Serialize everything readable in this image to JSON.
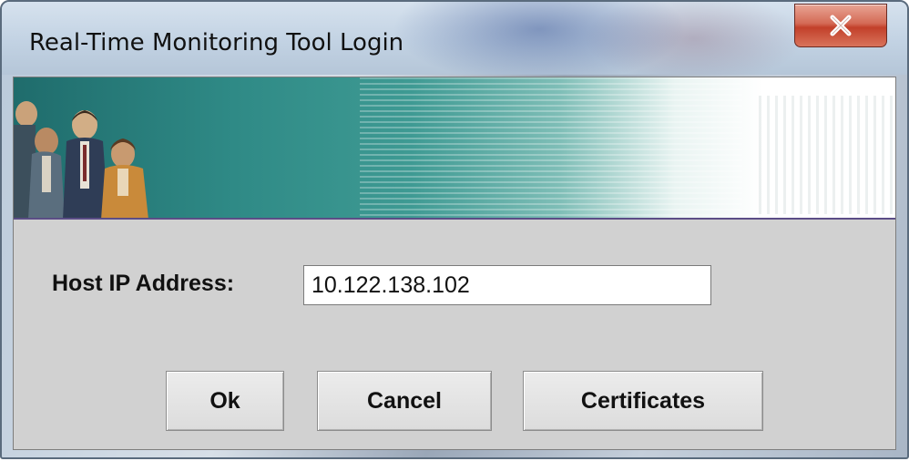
{
  "window": {
    "title": "Real-Time Monitoring Tool Login",
    "close_icon": "close-x-icon"
  },
  "banner": {
    "image": "people-banner-illustration"
  },
  "form": {
    "host_label": "Host IP Address:",
    "host_value": "10.122.138.102"
  },
  "buttons": {
    "ok": "Ok",
    "cancel": "Cancel",
    "certificates": "Certificates"
  },
  "colors": {
    "banner_teal": "#2f8a86",
    "banner_rule": "#5b4d86",
    "dialog_bg": "#d1d1d1",
    "close_red": "#c2402a"
  }
}
